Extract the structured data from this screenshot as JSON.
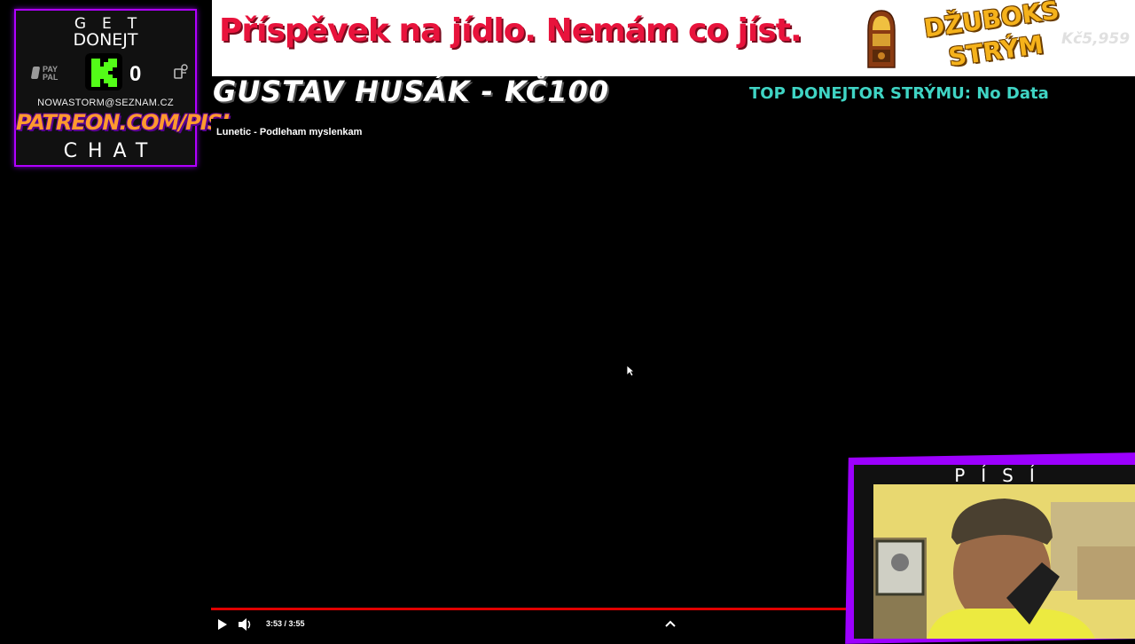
{
  "donate_panel": {
    "get_label": "GET",
    "donejt_label": "DONEJT",
    "paypal_label": "PAY PAL",
    "kick_count": "0",
    "email": "NOWASTORM@SEZNAM.CZ",
    "patreon": "PATREON.COM/PISI",
    "chat_label": "CHAT"
  },
  "banner": {
    "text": "Příspěvek na jídlo. Nemám co jíst.",
    "jukebox_title": "DŽUBOKS STRÝM",
    "amount": "Kč5,959"
  },
  "donor_line": "GUSTAV HUSÁK - KČ100",
  "top_donor": "TOP DONEJTOR STRÝMU: No Data",
  "player": {
    "title": "Lunetic - Podleham myslenkam",
    "time": "3:53 / 3:55",
    "progress": 0.99
  },
  "webcam": {
    "name": "PÍSÍ"
  },
  "colors": {
    "accent_purple": "#b000ff",
    "banner_red": "#e8133c",
    "kick_green": "#53fc18",
    "top_donor_teal": "#3fd4c4",
    "progress_red": "#e00000"
  },
  "icons": [
    "paypal-icon",
    "kick-icon",
    "donate-icon",
    "jukebox-icon",
    "play-icon",
    "volume-icon",
    "chevron-up-icon",
    "cursor-icon"
  ]
}
